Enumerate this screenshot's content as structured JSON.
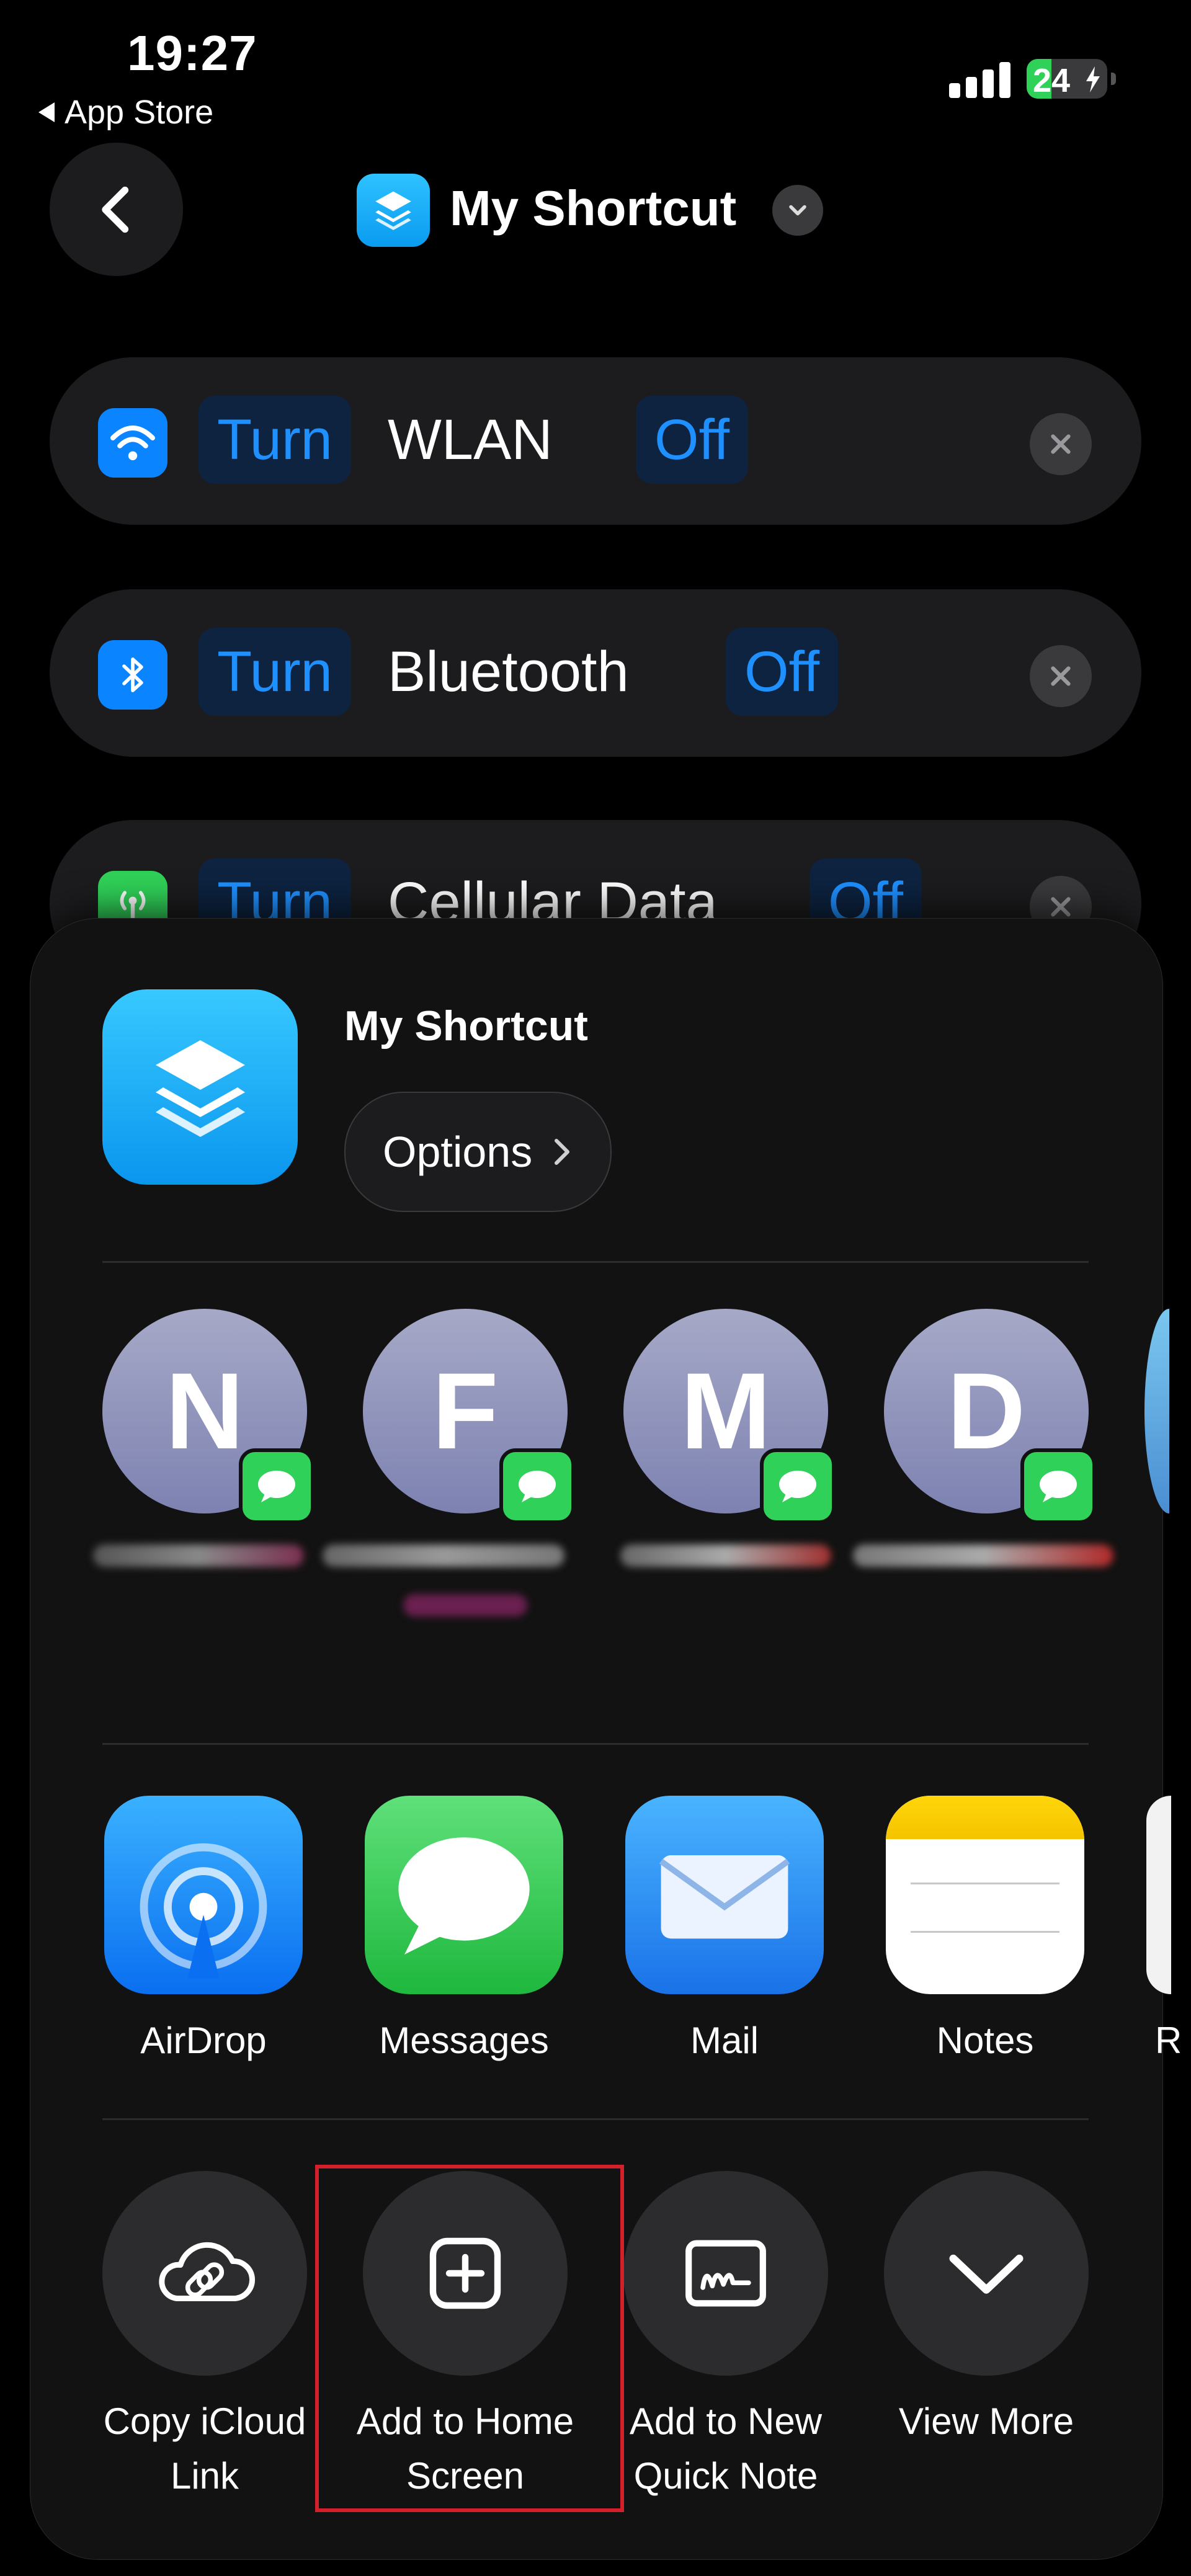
{
  "status_bar": {
    "time": "19:27",
    "back_app": "App Store",
    "battery": "24"
  },
  "nav": {
    "title": "My Shortcut"
  },
  "actions": [
    {
      "verb": "Turn",
      "object": "WLAN",
      "state": "Off",
      "icon": "wifi-icon"
    },
    {
      "verb": "Turn",
      "object": "Bluetooth",
      "state": "Off",
      "icon": "bluetooth-icon"
    },
    {
      "verb": "Turn",
      "object": "Cellular Data",
      "state": "Off",
      "icon": "cellular-icon"
    }
  ],
  "sheet": {
    "title": "My Shortcut",
    "options_label": "Options",
    "contacts": [
      {
        "initial": "N"
      },
      {
        "initial": "F"
      },
      {
        "initial": "M"
      },
      {
        "initial": "D"
      }
    ],
    "apps": [
      {
        "label": "AirDrop",
        "icon": "airdrop-icon"
      },
      {
        "label": "Messages",
        "icon": "messages-icon"
      },
      {
        "label": "Mail",
        "icon": "mail-icon"
      },
      {
        "label": "Notes",
        "icon": "notes-icon"
      },
      {
        "label": "R"
      }
    ],
    "quick_actions": [
      {
        "line1": "Copy iCloud",
        "line2": "Link",
        "icon": "icloud-link-icon"
      },
      {
        "line1": "Add to Home",
        "line2": "Screen",
        "icon": "add-square-icon"
      },
      {
        "line1": "Add to New",
        "line2": "Quick Note",
        "icon": "quick-note-icon"
      },
      {
        "line1": "View More",
        "line2": "",
        "icon": "chevron-down-icon"
      }
    ]
  },
  "colors": {
    "accent": "#1e90ff",
    "highlight": "#d4202a",
    "green": "#30d158",
    "shortcut_blue": "#0a9bf0"
  }
}
